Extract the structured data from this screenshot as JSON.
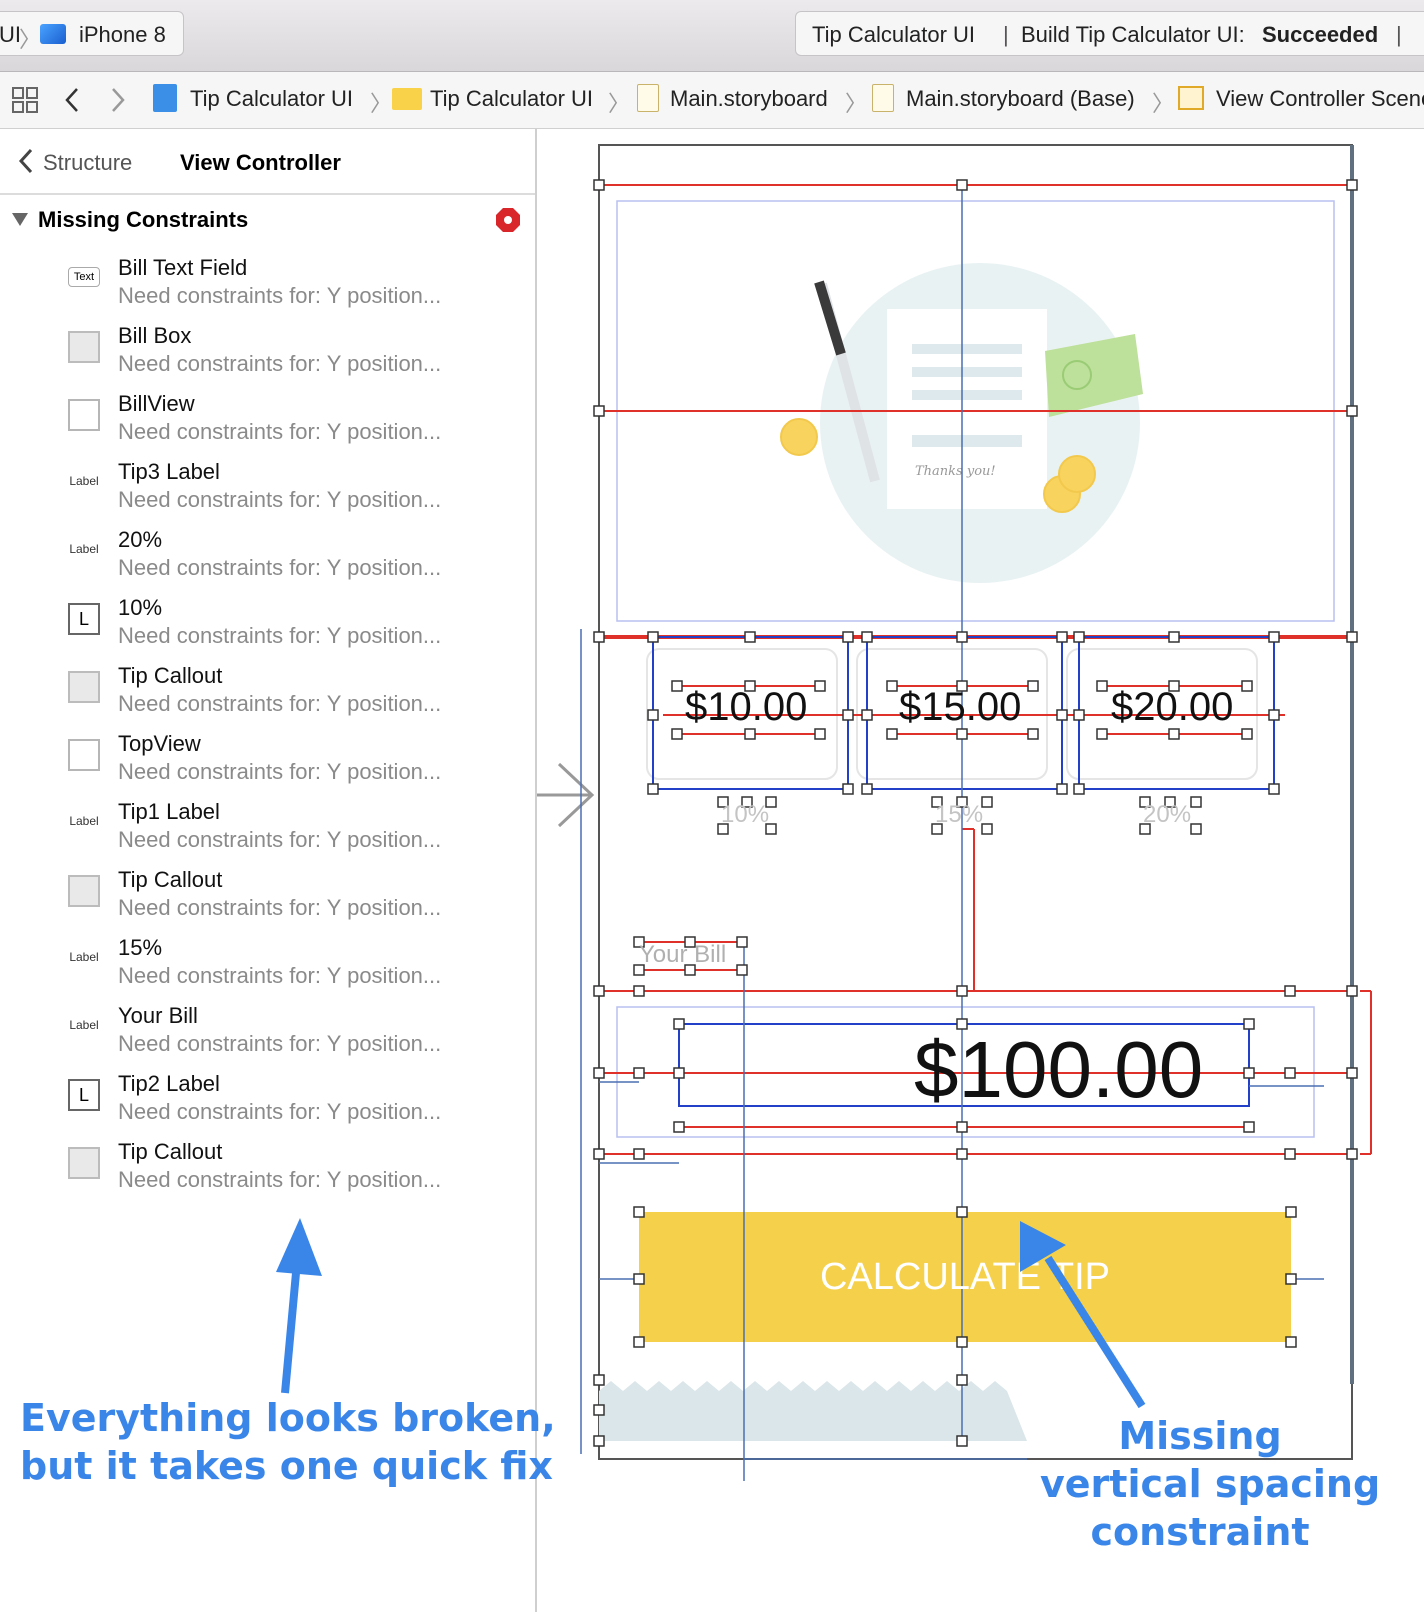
{
  "toolbar": {
    "scheme_left": "UI",
    "device": "iPhone 8",
    "status_project": "Tip Calculator UI",
    "status_build_prefix": "Build Tip Calculator UI:",
    "status_build_result": "Succeeded"
  },
  "jumpbar": {
    "items": [
      "Tip Calculator UI",
      "Tip Calculator UI",
      "Main.storyboard",
      "Main.storyboard (Base)",
      "View Controller Scene"
    ]
  },
  "issues": {
    "back_label": "Structure",
    "title": "View Controller",
    "section": "Missing Constraints",
    "items": [
      {
        "icon": "text-field-icon",
        "icon_text": "Text",
        "title": "Bill Text Field",
        "subtitle": "Need constraints for: Y position..."
      },
      {
        "icon": "image-view-icon",
        "title": "Bill Box",
        "subtitle": "Need constraints for: Y position..."
      },
      {
        "icon": "view-icon",
        "title": "BillView",
        "subtitle": "Need constraints for: Y position..."
      },
      {
        "icon": "label-icon",
        "icon_text": "Label",
        "title": "Tip3 Label",
        "subtitle": "Need constraints for: Y position..."
      },
      {
        "icon": "label-icon",
        "icon_text": "Label",
        "title": "20%",
        "subtitle": "Need constraints for: Y position..."
      },
      {
        "icon": "label-l-icon",
        "icon_text": "L",
        "title": "10%",
        "subtitle": "Need constraints for: Y position..."
      },
      {
        "icon": "image-view-icon",
        "title": "Tip Callout",
        "subtitle": "Need constraints for: Y position..."
      },
      {
        "icon": "view-icon",
        "title": "TopView",
        "subtitle": "Need constraints for: Y position..."
      },
      {
        "icon": "label-icon",
        "icon_text": "Label",
        "title": "Tip1 Label",
        "subtitle": "Need constraints for: Y position..."
      },
      {
        "icon": "image-view-icon",
        "title": "Tip Callout",
        "subtitle": "Need constraints for: Y position..."
      },
      {
        "icon": "label-icon",
        "icon_text": "Label",
        "title": "15%",
        "subtitle": "Need constraints for: Y position..."
      },
      {
        "icon": "label-icon",
        "icon_text": "Label",
        "title": "Your Bill",
        "subtitle": "Need constraints for: Y position..."
      },
      {
        "icon": "label-l-icon",
        "icon_text": "L",
        "title": "Tip2 Label",
        "subtitle": "Need constraints for: Y position..."
      },
      {
        "icon": "image-view-icon",
        "title": "Tip Callout",
        "subtitle": "Need constraints for: Y position..."
      }
    ]
  },
  "storyboard": {
    "tips": [
      "$10.00",
      "$15.00",
      "$20.00"
    ],
    "percents": [
      "10%",
      "15%",
      "20%"
    ],
    "bill_label": "Your Bill",
    "bill_amount": "$100.00",
    "button_label": "CALCULATE TIP",
    "receipt_note": "Thanks you!"
  },
  "annotations": {
    "left_line1": "Everything looks broken,",
    "left_line2": "but it takes one quick fix",
    "right_line1": "Missing",
    "right_line2": "vertical spacing",
    "right_line3": "constraint"
  },
  "colors": {
    "accent": "#3a86e8",
    "constraint_red": "#e0302a",
    "constraint_blue": "#2340c8",
    "button_yellow": "#f5d04a",
    "error_red": "#d9262a"
  }
}
